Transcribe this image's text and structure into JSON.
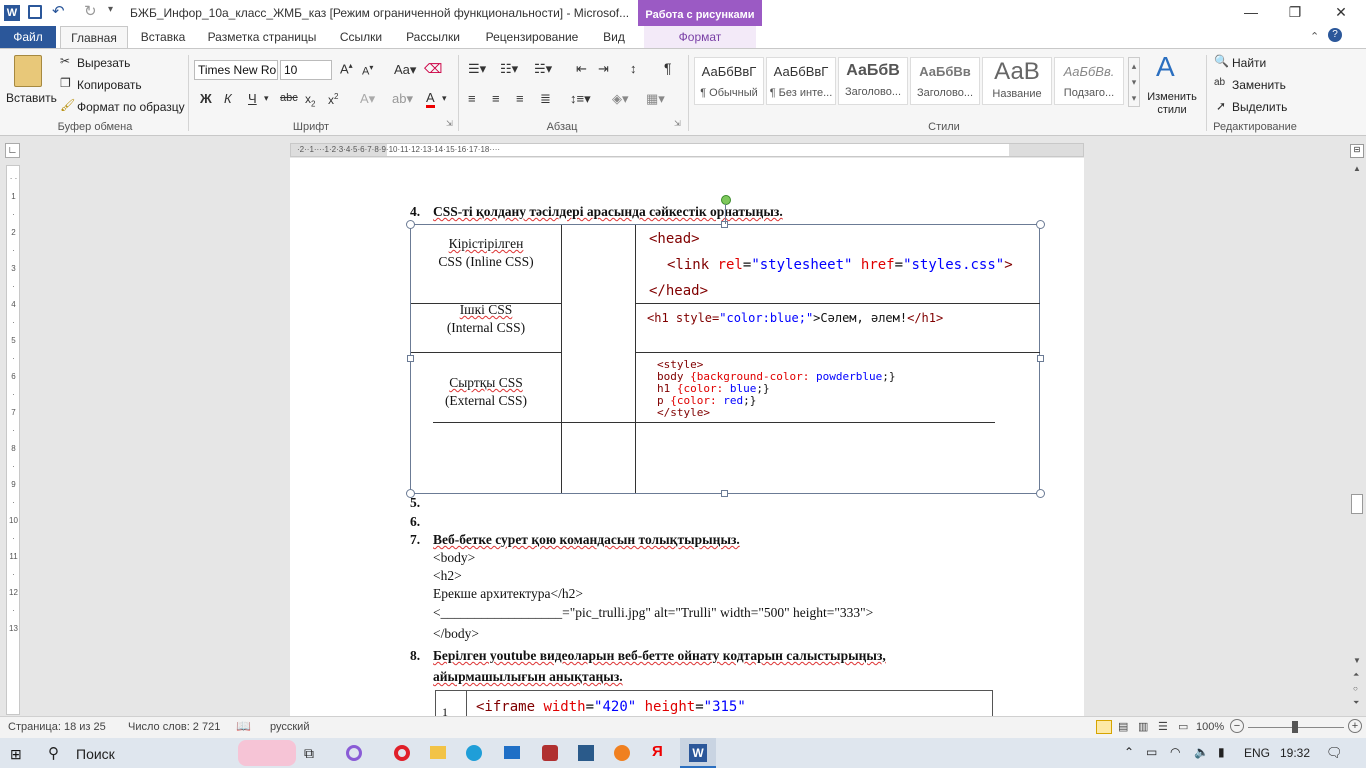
{
  "titlebar": {
    "doc_title": "БЖБ_Инфор_10а_класс_ЖМБ_каз [Режим ограниченной функциональности]  -  Microsof...",
    "context_tab": "Работа с рисунками"
  },
  "tabs": {
    "file": "Файл",
    "home": "Главная",
    "insert": "Вставка",
    "layout": "Разметка страницы",
    "refs": "Ссылки",
    "mail": "Рассылки",
    "review": "Рецензирование",
    "view": "Вид",
    "format": "Формат"
  },
  "ribbon": {
    "clipboard": {
      "paste": "Вставить",
      "cut": "Вырезать",
      "copy": "Копировать",
      "painter": "Формат по образцу",
      "group": "Буфер обмена"
    },
    "font": {
      "name": "Times New Ro",
      "size": "10",
      "group": "Шрифт"
    },
    "paragraph": {
      "group": "Абзац"
    },
    "styles": {
      "group": "Стили",
      "items": [
        {
          "preview": "АаБбВвГ",
          "name": "¶ Обычный"
        },
        {
          "preview": "АаБбВвГ",
          "name": "¶ Без инте..."
        },
        {
          "preview": "АаБбВ",
          "name": "Заголово..."
        },
        {
          "preview": "АаБбВв",
          "name": "Заголово..."
        },
        {
          "preview": "АаВ",
          "name": "Название"
        },
        {
          "preview": "АаБбВв.",
          "name": "Подзаго..."
        }
      ],
      "change": "Изменить стили"
    },
    "editing": {
      "find": "Найти",
      "replace": "Заменить",
      "select": "Выделить",
      "group": "Редактирование"
    }
  },
  "doc": {
    "q4": {
      "num": "4.",
      "text": "CSS-ті қолдану тәсілдері арасында сәйкестік орнатыңыз."
    },
    "table": {
      "left": [
        {
          "l1": "Кірістірілген",
          "l2": "CSS (Inline CSS)"
        },
        {
          "l1": "Ішкі CSS",
          "l2": "(Internal CSS)"
        },
        {
          "l1": "Сыртқы CSS",
          "l2": "(External CSS)"
        }
      ],
      "code1": {
        "a": "<head>",
        "b1": "<link ",
        "b2": "rel",
        "b3": "=",
        "b4": "\"stylesheet\"",
        "b5": " href",
        "b6": "=",
        "b7": "\"styles.css\"",
        "b8": ">",
        "c": "</head>"
      },
      "code2": {
        "a": "<h1 style=",
        "b": "\"color:blue;\"",
        "c": ">Сәлем, әлем!",
        "d": "</h1>"
      },
      "code3": {
        "l1": "<style>",
        "l2a": "body ",
        "l2b": "{background-color: ",
        "l2c": "powderblue",
        "l2d": ";}",
        "l3a": "h1   ",
        "l3b": "{color: ",
        "l3c": "blue",
        "l3d": ";}",
        "l4a": "p    ",
        "l4b": "{color: ",
        "l4c": "red",
        "l4d": ";}",
        "l5": "</style>"
      }
    },
    "n5": "5.",
    "n6": "6.",
    "q7": {
      "num": "7.",
      "text": "Веб-бетке сурет қою командасын толықтырыңыз.",
      "l1": "<body>",
      "l2": "<h2>",
      "l3": "Ерекше архитектура</h2>",
      "l4": "<__________________=\"pic_trulli.jpg\"  alt=\"Trulli\"  width=\"500\" height=\"333\">",
      "l5": "</body>"
    },
    "q8": {
      "num": "8.",
      "text1": "Берілген youtube видеоларын веб-бетте ойнату кодтарын салыстырыңыз,",
      "text2": "айырмашылығын анықтаңыз.",
      "row_num": "1",
      "code_a": "<iframe ",
      "code_b": "width",
      "code_c": "=",
      "code_d": "\"420\"",
      "code_e": " height",
      "code_f": "=",
      "code_g": "\"315\""
    }
  },
  "status": {
    "page": "Страница: 18 из 25",
    "words": "Число слов: 2 721",
    "lang": "русский",
    "zoom": "100%"
  },
  "taskbar": {
    "search": "Поиск",
    "lang": "ENG",
    "time": "19:32"
  }
}
